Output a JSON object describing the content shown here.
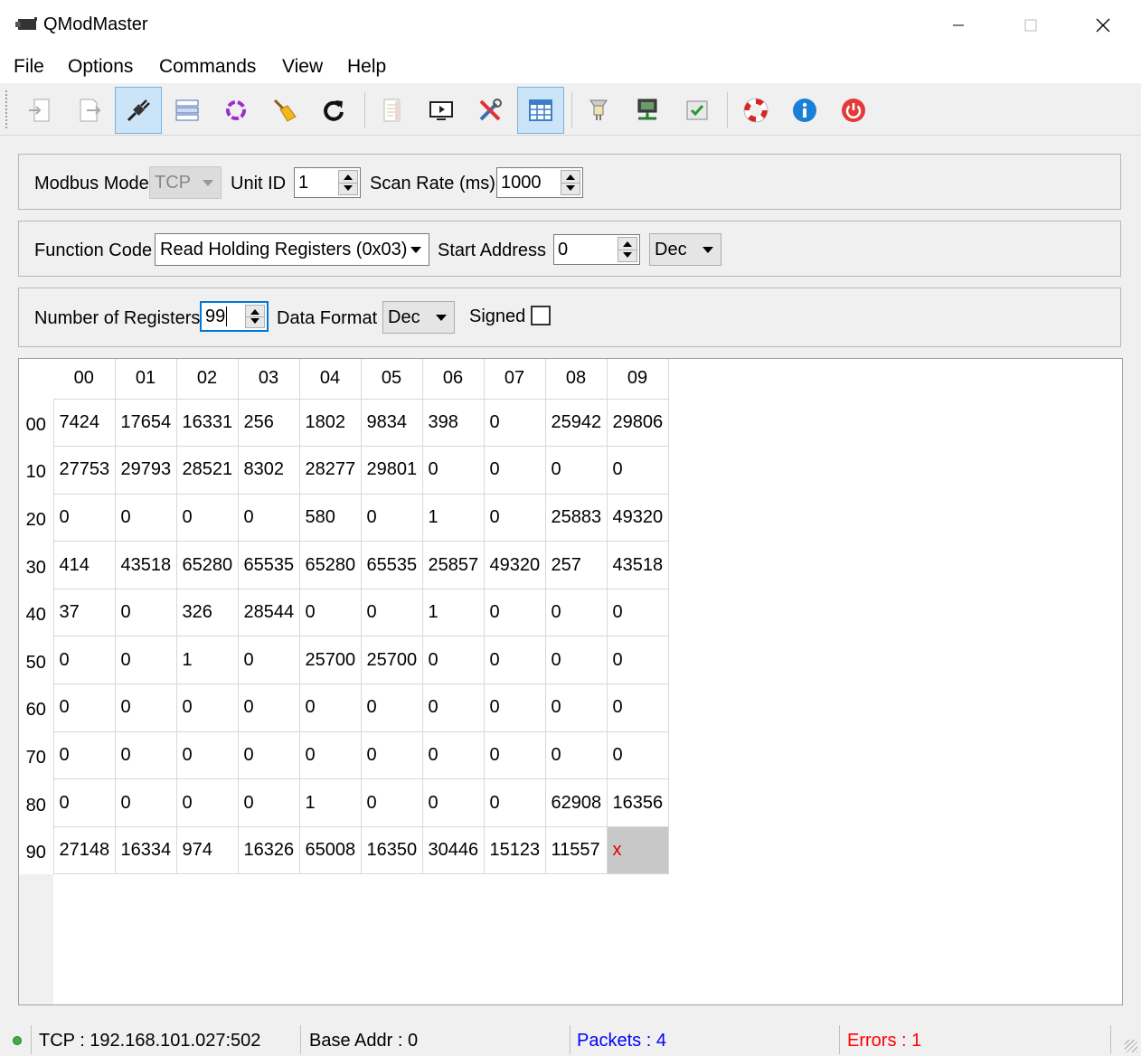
{
  "window": {
    "title": "QModMaster"
  },
  "menu": [
    "File",
    "Options",
    "Commands",
    "View",
    "Help"
  ],
  "toolbar": {
    "icons": [
      "connect-tcp-icon",
      "connect-rtu-icon",
      "plug-connect-icon",
      "scan-icon",
      "reset-counters-icon",
      "clear-icon",
      "refresh-icon",
      "log-icon",
      "bus-monitor-icon",
      "tools-icon",
      "table-icon",
      "header-info-icon",
      "network-icon",
      "options-icon",
      "help-lifebuoy-icon",
      "about-icon",
      "exit-icon"
    ]
  },
  "connection": {
    "modbus_mode_label": "Modbus Mode",
    "modbus_mode": "TCP",
    "unit_id_label": "Unit ID",
    "unit_id": "1",
    "scan_rate_label": "Scan Rate (ms)",
    "scan_rate": "1000"
  },
  "function": {
    "function_code_label": "Function Code",
    "function_code": "Read Holding Registers (0x03)",
    "start_address_label": "Start Address",
    "start_address": "0",
    "address_format": "Dec"
  },
  "format": {
    "num_registers_label": "Number of Registers",
    "num_registers": "99",
    "data_format_label": "Data Format",
    "data_format": "Dec",
    "signed_label": "Signed",
    "signed": false
  },
  "grid": {
    "columns": [
      "00",
      "01",
      "02",
      "03",
      "04",
      "05",
      "06",
      "07",
      "08",
      "09"
    ],
    "rows": [
      {
        "label": "00",
        "values": [
          "7424",
          "17654",
          "16331",
          "256",
          "1802",
          "9834",
          "398",
          "0",
          "25942",
          "29806"
        ]
      },
      {
        "label": "10",
        "values": [
          "27753",
          "29793",
          "28521",
          "8302",
          "28277",
          "29801",
          "0",
          "0",
          "0",
          "0"
        ]
      },
      {
        "label": "20",
        "values": [
          "0",
          "0",
          "0",
          "0",
          "580",
          "0",
          "1",
          "0",
          "25883",
          "49320"
        ]
      },
      {
        "label": "30",
        "values": [
          "414",
          "43518",
          "65280",
          "65535",
          "65280",
          "65535",
          "25857",
          "49320",
          "257",
          "43518"
        ]
      },
      {
        "label": "40",
        "values": [
          "37",
          "0",
          "326",
          "28544",
          "0",
          "0",
          "1",
          "0",
          "0",
          "0"
        ]
      },
      {
        "label": "50",
        "values": [
          "0",
          "0",
          "1",
          "0",
          "25700",
          "25700",
          "0",
          "0",
          "0",
          "0"
        ]
      },
      {
        "label": "60",
        "values": [
          "0",
          "0",
          "0",
          "0",
          "0",
          "0",
          "0",
          "0",
          "0",
          "0"
        ]
      },
      {
        "label": "70",
        "values": [
          "0",
          "0",
          "0",
          "0",
          "0",
          "0",
          "0",
          "0",
          "0",
          "0"
        ]
      },
      {
        "label": "80",
        "values": [
          "0",
          "0",
          "0",
          "0",
          "1",
          "0",
          "0",
          "0",
          "62908",
          "16356"
        ]
      },
      {
        "label": "90",
        "values": [
          "27148",
          "16334",
          "974",
          "16326",
          "65008",
          "16350",
          "30446",
          "15123",
          "11557",
          "x"
        ]
      }
    ]
  },
  "status": {
    "connection": "TCP : 192.168.101.027:502",
    "base_addr": "Base Addr : 0",
    "packets": "Packets : 4",
    "errors": "Errors : 1",
    "packets_color": "#0000ff",
    "errors_color": "#ff0000"
  }
}
